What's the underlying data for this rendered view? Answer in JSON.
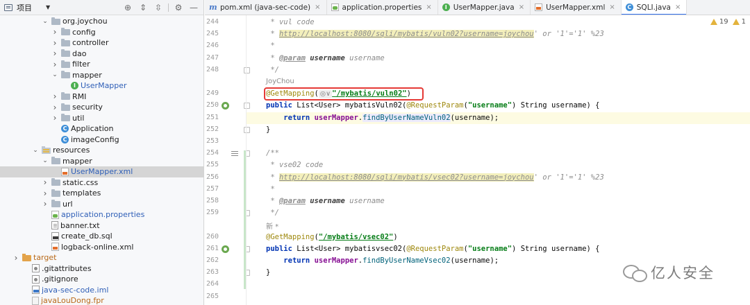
{
  "project": {
    "title": "项目",
    "tree": [
      {
        "label": "org.joychou",
        "icon": "folder",
        "arrow": "down",
        "indent": 4
      },
      {
        "label": "config",
        "icon": "folder",
        "arrow": "right",
        "indent": 5
      },
      {
        "label": "controller",
        "icon": "folder",
        "arrow": "right",
        "indent": 5
      },
      {
        "label": "dao",
        "icon": "folder",
        "arrow": "right",
        "indent": 5
      },
      {
        "label": "filter",
        "icon": "folder",
        "arrow": "right",
        "indent": 5
      },
      {
        "label": "mapper",
        "icon": "folder",
        "arrow": "down",
        "indent": 5
      },
      {
        "label": "UserMapper",
        "icon": "interface",
        "arrow": "",
        "indent": 6,
        "color": "blue"
      },
      {
        "label": "RMI",
        "icon": "folder",
        "arrow": "right",
        "indent": 5
      },
      {
        "label": "security",
        "icon": "folder",
        "arrow": "right",
        "indent": 5
      },
      {
        "label": "util",
        "icon": "folder",
        "arrow": "right",
        "indent": 5
      },
      {
        "label": "Application",
        "icon": "class",
        "arrow": "",
        "indent": 5
      },
      {
        "label": "imageConfig",
        "icon": "class",
        "arrow": "",
        "indent": 5
      },
      {
        "label": "resources",
        "icon": "folder-res",
        "arrow": "down",
        "indent": 3
      },
      {
        "label": "mapper",
        "icon": "folder",
        "arrow": "down",
        "indent": 4
      },
      {
        "label": "UserMapper.xml",
        "icon": "xml",
        "arrow": "",
        "indent": 5,
        "color": "blue",
        "selected": true
      },
      {
        "label": "static.css",
        "icon": "folder",
        "arrow": "right",
        "indent": 4
      },
      {
        "label": "templates",
        "icon": "folder",
        "arrow": "right",
        "indent": 4
      },
      {
        "label": "url",
        "icon": "folder",
        "arrow": "right",
        "indent": 4
      },
      {
        "label": "application.properties",
        "icon": "props",
        "arrow": "",
        "indent": 4,
        "color": "blue"
      },
      {
        "label": "banner.txt",
        "icon": "txt",
        "arrow": "",
        "indent": 4
      },
      {
        "label": "create_db.sql",
        "icon": "sql",
        "arrow": "",
        "indent": 4
      },
      {
        "label": "logback-online.xml",
        "icon": "xml",
        "arrow": "",
        "indent": 4
      },
      {
        "label": "target",
        "icon": "folder-target",
        "arrow": "right",
        "indent": 1,
        "color": "orange"
      },
      {
        "label": ".gitattributes",
        "icon": "git",
        "arrow": "",
        "indent": 2
      },
      {
        "label": ".gitignore",
        "icon": "git",
        "arrow": "",
        "indent": 2
      },
      {
        "label": "java-sec-code.iml",
        "icon": "iml",
        "arrow": "",
        "indent": 2,
        "color": "blue"
      },
      {
        "label": "javaLouDong.fpr",
        "icon": "fpr",
        "arrow": "",
        "indent": 2,
        "color": "orange"
      }
    ]
  },
  "tabs": [
    {
      "label": "pom.xml (java-sec-code)",
      "icon": "maven",
      "active": false
    },
    {
      "label": "application.properties",
      "icon": "props",
      "active": false
    },
    {
      "label": "UserMapper.java",
      "icon": "interface",
      "active": false
    },
    {
      "label": "UserMapper.xml",
      "icon": "xml",
      "active": false
    },
    {
      "label": "SQLI.java",
      "icon": "class",
      "active": true
    }
  ],
  "inspections": {
    "warnings": "19",
    "other": "1"
  },
  "editor": {
    "lines": [
      {
        "n": "244",
        "html": "<span class='doc'> * vul code</span>"
      },
      {
        "n": "245",
        "html": "<span class='doc'> * </span><span class='doclink'>http://localhost:8080/sqli/mybatis/vuln02?username=joychou</span><span class='doc'>' or '1'='1' %23</span>"
      },
      {
        "n": "246",
        "html": "<span class='doc'> *</span>"
      },
      {
        "n": "247",
        "html": "<span class='doc'> * </span><span class='doctag'>@param</span><span class='doc'> </span><span class='docparam'>username</span><span class='doc'> username</span>"
      },
      {
        "n": "248",
        "html": "<span class='doc'> */</span>"
      },
      {
        "n": "",
        "author": "JoyChou"
      },
      {
        "n": "249",
        "html": "<span class='ann'>@GetMapping</span><span class='plain'>(</span><span class='inlay'>◎∨</span><span class='strlink'>\"/mybatis/vuln02\"</span><span class='plain'>)</span>"
      },
      {
        "n": "250",
        "html": "<span class='kw'>public</span><span class='plain'> List&lt;User&gt; mybatisVuln02(</span><span class='ann'>@RequestParam</span><span class='plain'>(</span><span class='str'>\"username\"</span><span class='plain'>) String username) {</span>"
      },
      {
        "n": "251",
        "html": "<span class='plain'>    </span><span class='kw'>return</span><span class='plain'> </span><span class='fld'>userMapper</span><span class='plain'>.</span><span class='mcall bg'>findByUserNameVuln02</span><span class='plain'>(username);</span>",
        "highlight": true
      },
      {
        "n": "252",
        "html": "<span class='plain'>}</span>"
      },
      {
        "n": "253",
        "html": ""
      },
      {
        "n": "254",
        "html": "<span class='doc'>/**</span>"
      },
      {
        "n": "255",
        "html": "<span class='doc'> * vse02 code</span>"
      },
      {
        "n": "256",
        "html": "<span class='doc'> * </span><span class='doclink'>http://localhost:8080/sqli/mybatis/vsec02?username=joychou</span><span class='doc'>' or '1'='1' %23</span>"
      },
      {
        "n": "257",
        "html": "<span class='doc'> *</span>"
      },
      {
        "n": "258",
        "html": "<span class='doc'> * </span><span class='doctag'>@param</span><span class='doc'> </span><span class='docparam'>username</span><span class='doc'> username</span>"
      },
      {
        "n": "259",
        "html": "<span class='doc'> */</span>"
      },
      {
        "n": "",
        "author": "新 *"
      },
      {
        "n": "260",
        "html": "<span class='ann'>@GetMapping</span><span class='plain'>(</span><span class='strlink'>\"/mybatis/vsec02\"</span><span class='plain'>)</span>"
      },
      {
        "n": "261",
        "html": "<span class='kw'>public</span><span class='plain'> List&lt;User&gt; mybatisvsec02(</span><span class='ann'>@RequestParam</span><span class='plain'>(</span><span class='str'>\"username\"</span><span class='plain'>) String username) {</span>"
      },
      {
        "n": "262",
        "html": "<span class='plain'>    </span><span class='kw'>return</span><span class='plain'> </span><span class='fld'>userMapper</span><span class='plain'>.</span><span class='mcall'>findByUserNameVsec02</span><span class='plain'>(username);</span>"
      },
      {
        "n": "263",
        "html": "<span class='plain'>}</span>"
      },
      {
        "n": "264",
        "html": ""
      },
      {
        "n": "265",
        "html": ""
      }
    ]
  },
  "watermark": {
    "text": "亿人安全"
  },
  "colors": {
    "accent": "#3574f0",
    "highlight_box": "#e53935"
  }
}
